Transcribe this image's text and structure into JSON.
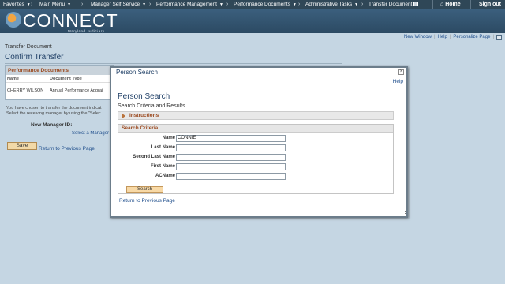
{
  "nav": {
    "favorites": "Favorites",
    "main_menu": "Main Menu",
    "items": [
      "Manager Self Service",
      "Performance Management",
      "Performance Documents",
      "Administrative Tasks",
      "Transfer Document"
    ],
    "home": "Home",
    "signout": "Sign out"
  },
  "brand": {
    "logo": "CONNECT",
    "sub": "Maryland Judiciary"
  },
  "util": {
    "new_window": "New Window",
    "help": "Help",
    "personalize": "Personalize Page"
  },
  "page": {
    "breadcrumb": "Transfer Document",
    "title": "Confirm Transfer",
    "grid_title": "Performance Documents",
    "col_name": "Name",
    "col_type": "Document Type",
    "row_name": "CHERRY WILSON",
    "row_type": "Annual Performance Apprai",
    "msg_line1": "You have chosen to transfer the document indicat",
    "msg_line2": "Select the receiving manager by using the \"Selec",
    "new_manager_label": "New Manager ID:",
    "select_manager": "Select a Manager",
    "save": "Save",
    "return": "Return to Previous Page"
  },
  "modal": {
    "title": "Person Search",
    "help": "Help",
    "heading": "Person Search",
    "subheading": "Search Criteria and Results",
    "instructions": "Instructions",
    "criteria_title": "Search Criteria",
    "fields": [
      {
        "label": "Name",
        "value": "CONNIE"
      },
      {
        "label": "Last Name",
        "value": ""
      },
      {
        "label": "Second Last Name",
        "value": ""
      },
      {
        "label": "First Name",
        "value": ""
      },
      {
        "label": "ACName",
        "value": ""
      }
    ],
    "search": "Search",
    "return": "Return to Previous Page"
  }
}
